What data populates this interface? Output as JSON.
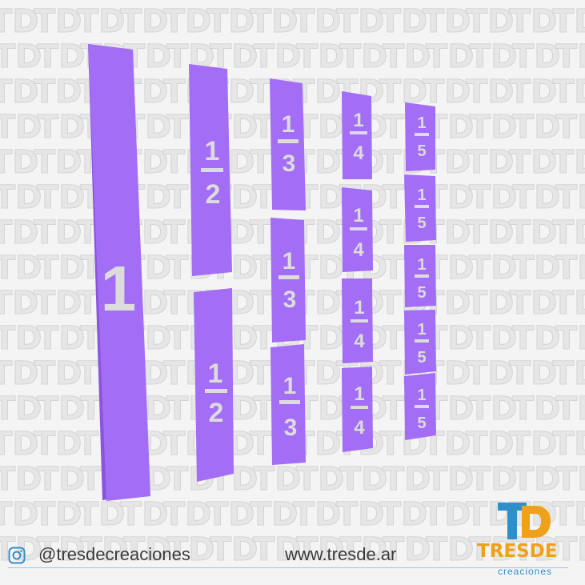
{
  "watermark": {
    "text": "TD"
  },
  "pieces": {
    "whole": {
      "label": "1"
    },
    "halves": {
      "numerator": "1",
      "denominator": "2",
      "count": 2
    },
    "thirds": {
      "numerator": "1",
      "denominator": "3",
      "count": 3
    },
    "fourths": {
      "numerator": "1",
      "denominator": "4",
      "count": 4
    },
    "fifths": {
      "numerator": "1",
      "denominator": "5",
      "count": 5
    }
  },
  "footer": {
    "instagram_handle": "@tresdecreaciones",
    "website": "www.tresde.ar",
    "icon": "instagram-icon"
  },
  "brand": {
    "logo_letters": "TD",
    "name": "TRESDE",
    "tagline": "creaciones"
  },
  "colors": {
    "piece_front": "#a36df5",
    "piece_side": "#8a55dc",
    "digit": "#dcdcdc",
    "brand_orange": "#f0a11a",
    "brand_blue": "#2f8fcb",
    "background": "#f4f4f4"
  }
}
